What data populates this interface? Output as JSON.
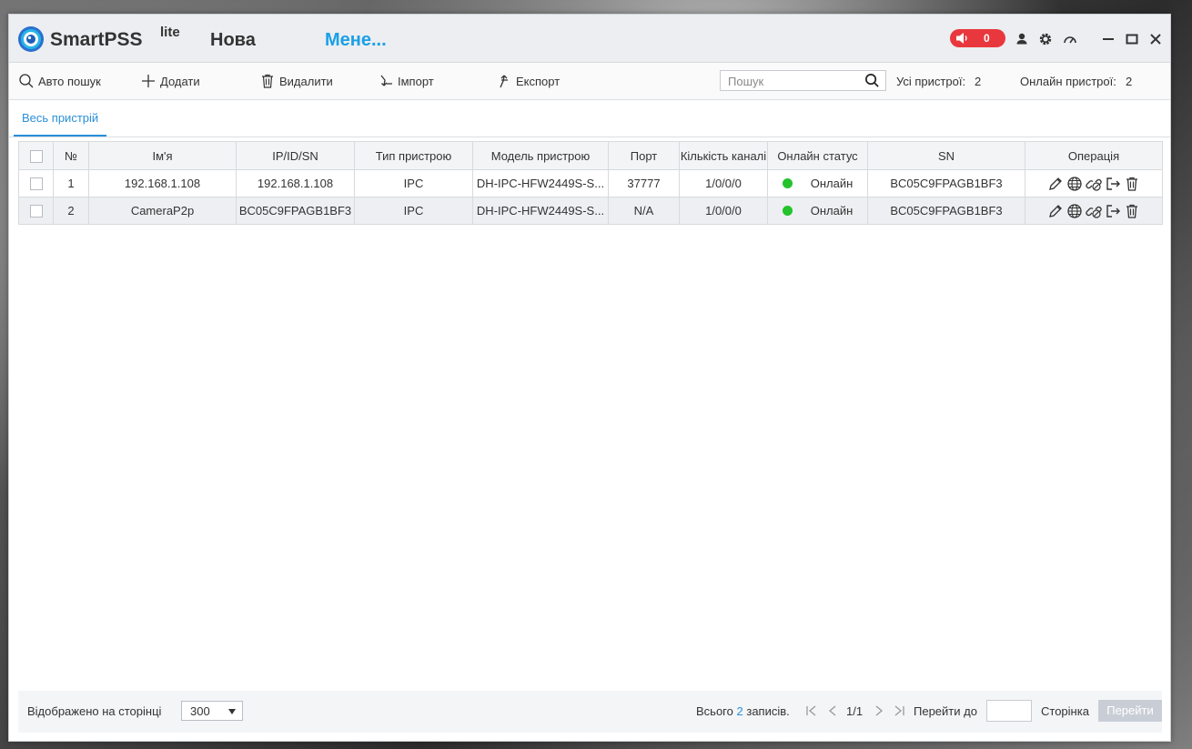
{
  "app": {
    "brand": "SmartPSS",
    "brand_suffix": "lite",
    "tabs": [
      "Нова",
      "Мене..."
    ],
    "alarm_count": "0"
  },
  "toolbar": {
    "auto_search": "Авто пошук",
    "add": "Додати",
    "delete": "Видалити",
    "import": "Імпорт",
    "export": "Експорт",
    "search_placeholder": "Пошук",
    "all_devices_label": "Усі пристрої:",
    "all_devices_count": "2",
    "online_devices_label": "Онлайн пристрої:",
    "online_devices_count": "2"
  },
  "main_tab": "Весь пристрій",
  "table": {
    "headers": [
      "№",
      "Ім'я",
      "IP/ID/SN",
      "Тип пристрою",
      "Модель пристрою",
      "Порт",
      "Кількість каналі",
      "Онлайн статус",
      "SN",
      "Операція"
    ],
    "rows": [
      {
        "no": "1",
        "name": "192.168.1.108",
        "ip": "192.168.1.108",
        "type": "IPC",
        "model": "DH-IPC-HFW2449S-S...",
        "port": "37777",
        "channels": "1/0/0/0",
        "status": "Онлайн",
        "sn": "BC05C9FPAGB1BF3"
      },
      {
        "no": "2",
        "name": "CameraP2p",
        "ip": "BC05C9FPAGB1BF3",
        "type": "IPC",
        "model": "DH-IPC-HFW2449S-S...",
        "port": "N/A",
        "channels": "1/0/0/0",
        "status": "Онлайн",
        "sn": "BC05C9FPAGB1BF3"
      }
    ]
  },
  "footer": {
    "per_page_label": "Відображено на сторінці",
    "per_page_value": "300",
    "total_prefix": "Всього",
    "total_count": "2",
    "total_suffix": "записів.",
    "page_indicator": "1/1",
    "goto_label": "Перейти до",
    "page_label": "Сторінка",
    "go_button": "Перейти"
  },
  "colors": {
    "accent": "#1aa0e6",
    "tab_active": "#2a8fd7",
    "alarm": "#e8383d",
    "online_dot": "#22c32b"
  }
}
